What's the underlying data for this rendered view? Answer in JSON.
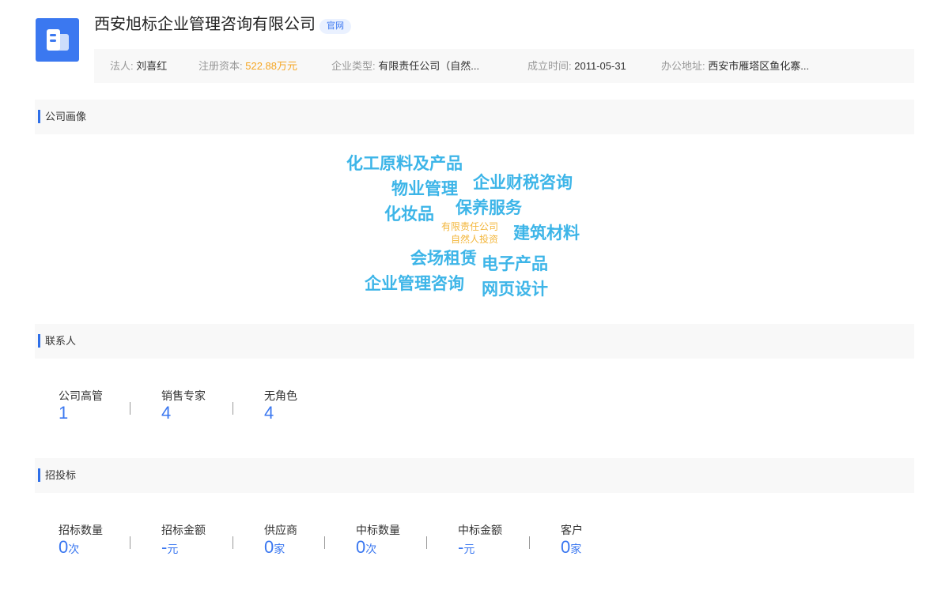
{
  "header": {
    "company_name": "西安旭标企业管理咨询有限公司",
    "official_tag": "官网",
    "logo_icon": "building-icon",
    "accent": "#3b78f0"
  },
  "info": {
    "legal_label": "法人:",
    "legal_value": "刘喜红",
    "capital_label": "注册资本:",
    "capital_value": "522.88万元",
    "type_label": "企业类型:",
    "type_value": "有限责任公司（自然...",
    "founded_label": "成立时间:",
    "founded_value": "2011-05-31",
    "address_label": "办公地址:",
    "address_value": "西安市雁塔区鱼化寨..."
  },
  "portrait": {
    "title": "公司画像",
    "tags": [
      "化工原料及产品",
      "物业管理",
      "企业财税咨询",
      "化妆品",
      "保养服务",
      "有限责任公司",
      "自然人投资",
      "建筑材料",
      "会场租赁",
      "电子产品",
      "企业管理咨询",
      "网页设计"
    ]
  },
  "contacts": {
    "title": "联系人",
    "items": [
      {
        "label": "公司高管",
        "value": "1"
      },
      {
        "label": "销售专家",
        "value": "4"
      },
      {
        "label": "无角色",
        "value": "4"
      }
    ]
  },
  "bidding": {
    "title": "招投标",
    "items": [
      {
        "label": "招标数量",
        "value": "0",
        "unit": "次"
      },
      {
        "label": "招标金额",
        "value": "-",
        "unit": "元"
      },
      {
        "label": "供应商",
        "value": "0",
        "unit": "家"
      },
      {
        "label": "中标数量",
        "value": "0",
        "unit": "次"
      },
      {
        "label": "中标金额",
        "value": "-",
        "unit": "元"
      },
      {
        "label": "客户",
        "value": "0",
        "unit": "家"
      }
    ]
  }
}
